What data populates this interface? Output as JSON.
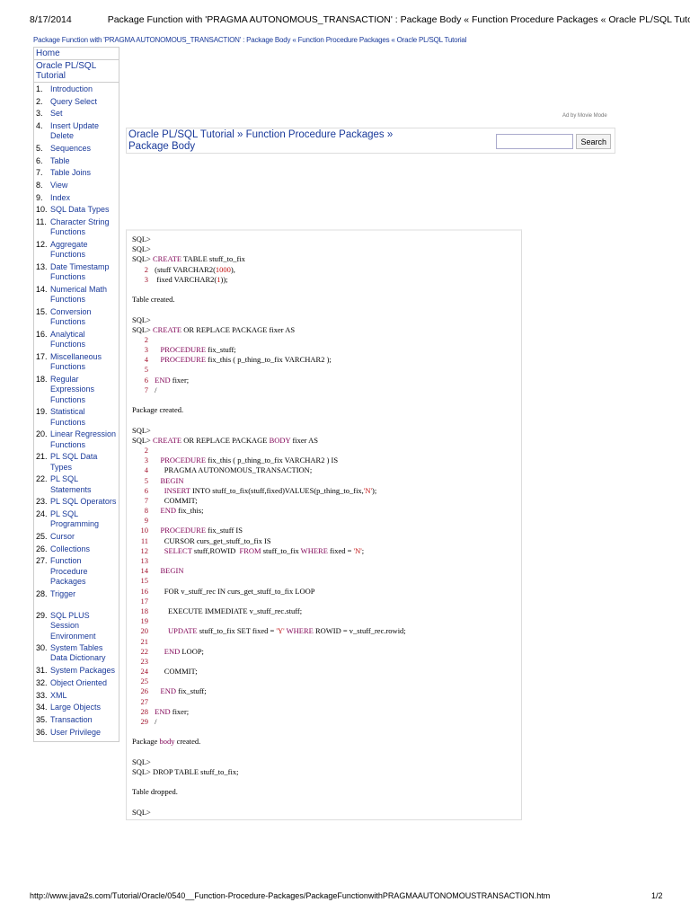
{
  "print_header": {
    "date": "8/17/2014",
    "title": "Package Function with 'PRAGMA AUTONOMOUS_TRANSACTION' : Package Body « Function Procedure Packages « Oracle PL/SQL Tutorial"
  },
  "top_link": "Package Function with 'PRAGMA AUTONOMOUS_TRANSACTION' : Package Body « Function Procedure Packages « Oracle PL/SQL Tutorial",
  "sidebar": {
    "home": "Home",
    "section": "Oracle PL/SQL Tutorial",
    "items": [
      {
        "n": "1.",
        "l": "Introduction"
      },
      {
        "n": "2.",
        "l": "Query Select"
      },
      {
        "n": "3.",
        "l": "Set"
      },
      {
        "n": "4.",
        "l": "Insert Update Delete"
      },
      {
        "n": "5.",
        "l": "Sequences"
      },
      {
        "n": "6.",
        "l": "Table"
      },
      {
        "n": "7.",
        "l": "Table Joins"
      },
      {
        "n": "8.",
        "l": "View"
      },
      {
        "n": "9.",
        "l": "Index"
      },
      {
        "n": "10.",
        "l": "SQL Data Types"
      },
      {
        "n": "11.",
        "l": "Character String Functions"
      },
      {
        "n": "12.",
        "l": "Aggregate Functions"
      },
      {
        "n": "13.",
        "l": "Date Timestamp Functions"
      },
      {
        "n": "14.",
        "l": "Numerical Math Functions"
      },
      {
        "n": "15.",
        "l": "Conversion Functions"
      },
      {
        "n": "16.",
        "l": "Analytical Functions"
      },
      {
        "n": "17.",
        "l": "Miscellaneous Functions"
      },
      {
        "n": "18.",
        "l": "Regular Expressions Functions"
      },
      {
        "n": "19.",
        "l": "Statistical Functions"
      },
      {
        "n": "20.",
        "l": "Linear Regression Functions"
      },
      {
        "n": "21.",
        "l": "PL SQL Data Types"
      },
      {
        "n": "22.",
        "l": "PL SQL Statements"
      },
      {
        "n": "23.",
        "l": "PL SQL Operators"
      },
      {
        "n": "24.",
        "l": "PL SQL Programming"
      },
      {
        "n": "25.",
        "l": "Cursor"
      },
      {
        "n": "26.",
        "l": "Collections"
      },
      {
        "n": "27.",
        "l": "Function Procedure Packages"
      },
      {
        "n": "28.",
        "l": "Trigger"
      },
      {
        "n": "29.",
        "l": "SQL PLUS Session Environment"
      },
      {
        "n": "30.",
        "l": "System Tables Data Dictionary"
      },
      {
        "n": "31.",
        "l": "System Packages"
      },
      {
        "n": "32.",
        "l": "Object Oriented"
      },
      {
        "n": "33.",
        "l": "XML"
      },
      {
        "n": "34.",
        "l": "Large Objects"
      },
      {
        "n": "35.",
        "l": "Transaction"
      },
      {
        "n": "36.",
        "l": "User Privilege"
      }
    ]
  },
  "ad_label": "Ad by Movie Mode",
  "breadcrumb": "Oracle PL/SQL Tutorial » Function Procedure Packages » Package Body",
  "search": {
    "value": "",
    "button": "Search"
  },
  "code": [
    {
      "s": [
        [
          "SQL>"
        ]
      ]
    },
    {
      "s": [
        [
          "SQL>"
        ]
      ]
    },
    {
      "s": [
        [
          "SQL> "
        ],
        [
          "CREATE",
          "k"
        ],
        [
          " TABLE stuff_to_fix"
        ]
      ]
    },
    {
      "n": "2",
      "s": [
        [
          " (stuff VARCHAR2("
        ],
        [
          "1000",
          "n"
        ],
        [
          "),"
        ]
      ]
    },
    {
      "n": "3",
      "s": [
        [
          "  fixed VARCHAR2("
        ],
        [
          "1",
          "n"
        ],
        [
          "));"
        ]
      ]
    },
    {
      "s": [
        [
          ""
        ]
      ]
    },
    {
      "s": [
        [
          "Table created."
        ]
      ]
    },
    {
      "s": [
        [
          ""
        ]
      ]
    },
    {
      "s": [
        [
          "SQL>"
        ]
      ]
    },
    {
      "s": [
        [
          "SQL> "
        ],
        [
          "CREATE",
          "k"
        ],
        [
          " OR REPLACE PACKAGE fixer AS"
        ]
      ]
    },
    {
      "n": "2",
      "s": [
        [
          ""
        ]
      ]
    },
    {
      "n": "3",
      "s": [
        [
          "    "
        ],
        [
          "PROCEDURE",
          "k"
        ],
        [
          " fix_stuff;"
        ]
      ]
    },
    {
      "n": "4",
      "s": [
        [
          "    "
        ],
        [
          "PROCEDURE",
          "k"
        ],
        [
          " fix_this ( p_thing_to_fix VARCHAR2 );"
        ]
      ]
    },
    {
      "n": "5",
      "s": [
        [
          ""
        ]
      ]
    },
    {
      "n": "6",
      "s": [
        [
          " "
        ],
        [
          "END",
          "k"
        ],
        [
          " fixer;"
        ]
      ]
    },
    {
      "n": "7",
      "s": [
        [
          " /"
        ]
      ]
    },
    {
      "s": [
        [
          ""
        ]
      ]
    },
    {
      "s": [
        [
          "Package created."
        ]
      ]
    },
    {
      "s": [
        [
          ""
        ]
      ]
    },
    {
      "s": [
        [
          "SQL>"
        ]
      ]
    },
    {
      "s": [
        [
          "SQL> "
        ],
        [
          "CREATE",
          "k"
        ],
        [
          " OR REPLACE PACKAGE "
        ],
        [
          "BODY",
          "k"
        ],
        [
          " fixer AS"
        ]
      ]
    },
    {
      "n": "2",
      "s": [
        [
          ""
        ]
      ]
    },
    {
      "n": "3",
      "s": [
        [
          "    "
        ],
        [
          "PROCEDURE",
          "k"
        ],
        [
          " fix_this ( p_thing_to_fix VARCHAR2 ) IS"
        ]
      ]
    },
    {
      "n": "4",
      "s": [
        [
          "      PRAGMA AUTONOMOUS_TRANSACTION;"
        ]
      ]
    },
    {
      "n": "5",
      "s": [
        [
          "    "
        ],
        [
          "BEGIN",
          "k"
        ]
      ]
    },
    {
      "n": "6",
      "s": [
        [
          "      "
        ],
        [
          "INSERT",
          "k"
        ],
        [
          " INTO stuff_to_fix(stuff,fixed)VALUES(p_thing_to_fix,"
        ],
        [
          "'N'",
          "s"
        ],
        [
          ");"
        ]
      ]
    },
    {
      "n": "7",
      "s": [
        [
          "      COMMIT;"
        ]
      ]
    },
    {
      "n": "8",
      "s": [
        [
          "    "
        ],
        [
          "END",
          "k"
        ],
        [
          " fix_this;"
        ]
      ]
    },
    {
      "n": "9",
      "s": [
        [
          ""
        ]
      ]
    },
    {
      "n": "10",
      "s": [
        [
          "    "
        ],
        [
          "PROCEDURE",
          "k"
        ],
        [
          " fix_stuff IS"
        ]
      ]
    },
    {
      "n": "11",
      "s": [
        [
          "      CURSOR curs_get_stuff_to_fix IS"
        ]
      ]
    },
    {
      "n": "12",
      "s": [
        [
          "      "
        ],
        [
          "SELECT",
          "k"
        ],
        [
          " stuff,ROWID  "
        ],
        [
          "FROM",
          "k"
        ],
        [
          " stuff_to_fix "
        ],
        [
          "WHERE",
          "k"
        ],
        [
          " fixed = "
        ],
        [
          "'N'",
          "s"
        ],
        [
          ";"
        ]
      ]
    },
    {
      "n": "13",
      "s": [
        [
          ""
        ]
      ]
    },
    {
      "n": "14",
      "s": [
        [
          "    "
        ],
        [
          "BEGIN",
          "k"
        ]
      ]
    },
    {
      "n": "15",
      "s": [
        [
          ""
        ]
      ]
    },
    {
      "n": "16",
      "s": [
        [
          "      FOR v_stuff_rec IN curs_get_stuff_to_fix LOOP"
        ]
      ]
    },
    {
      "n": "17",
      "s": [
        [
          ""
        ]
      ]
    },
    {
      "n": "18",
      "s": [
        [
          "        EXECUTE IMMEDIATE v_stuff_rec.stuff;"
        ]
      ]
    },
    {
      "n": "19",
      "s": [
        [
          ""
        ]
      ]
    },
    {
      "n": "20",
      "s": [
        [
          "        "
        ],
        [
          "UPDATE",
          "k"
        ],
        [
          " stuff_to_fix SET fixed = "
        ],
        [
          "'Y'",
          "s"
        ],
        [
          " "
        ],
        [
          "WHERE",
          "k"
        ],
        [
          " ROWID = v_stuff_rec.rowid;"
        ]
      ]
    },
    {
      "n": "21",
      "s": [
        [
          ""
        ]
      ]
    },
    {
      "n": "22",
      "s": [
        [
          "      "
        ],
        [
          "END",
          "k"
        ],
        [
          " LOOP;"
        ]
      ]
    },
    {
      "n": "23",
      "s": [
        [
          ""
        ]
      ]
    },
    {
      "n": "24",
      "s": [
        [
          "      COMMIT;"
        ]
      ]
    },
    {
      "n": "25",
      "s": [
        [
          ""
        ]
      ]
    },
    {
      "n": "26",
      "s": [
        [
          "    "
        ],
        [
          "END",
          "k"
        ],
        [
          " fix_stuff;"
        ]
      ]
    },
    {
      "n": "27",
      "s": [
        [
          ""
        ]
      ]
    },
    {
      "n": "28",
      "s": [
        [
          " "
        ],
        [
          "END",
          "k"
        ],
        [
          " fixer;"
        ]
      ]
    },
    {
      "n": "29",
      "s": [
        [
          " /"
        ]
      ]
    },
    {
      "s": [
        [
          ""
        ]
      ]
    },
    {
      "s": [
        [
          "Package "
        ],
        [
          "body",
          "k"
        ],
        [
          " created."
        ]
      ]
    },
    {
      "s": [
        [
          ""
        ]
      ]
    },
    {
      "s": [
        [
          "SQL>"
        ]
      ]
    },
    {
      "s": [
        [
          "SQL> DROP TABLE stuff_to_fix;"
        ]
      ]
    },
    {
      "s": [
        [
          ""
        ]
      ]
    },
    {
      "s": [
        [
          "Table dropped."
        ]
      ]
    },
    {
      "s": [
        [
          ""
        ]
      ]
    },
    {
      "s": [
        [
          "SQL>"
        ]
      ]
    }
  ],
  "footer": {
    "url": "http://www.java2s.com/Tutorial/Oracle/0540__Function-Procedure-Packages/PackageFunctionwithPRAGMAAUTONOMOUSTRANSACTION.htm",
    "page": "1/2"
  }
}
